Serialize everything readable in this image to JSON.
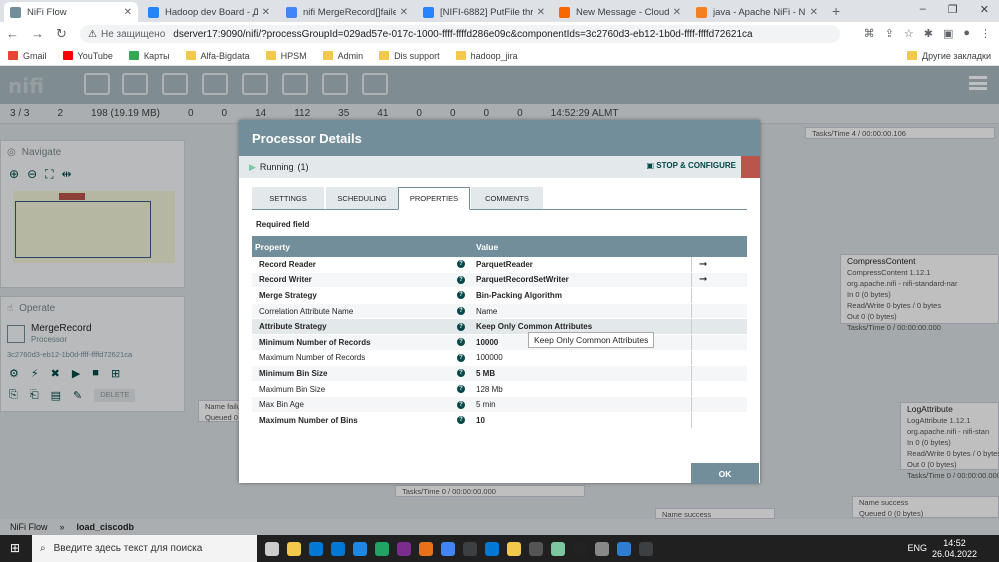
{
  "browser": {
    "tabs": [
      {
        "title": "NiFi Flow",
        "color": "#728e9b"
      },
      {
        "title": "Hadoop dev Board - Доска",
        "color": "#2684ff"
      },
      {
        "title": "nifi MergeRecord[]failed to",
        "color": "#4285f4"
      },
      {
        "title": "[NIFI-6882] PutFile throws",
        "color": "#2684ff"
      },
      {
        "title": "New Message - Cloudera C",
        "color": "#f96702"
      },
      {
        "title": "java - Apache NiFi - NullPo",
        "color": "#f48024"
      }
    ],
    "security_label": "Не защищено",
    "url": "dserver17:9090/nifi/?processGroupId=029ad57e-017c-1000-ffff-ffffd286e09c&componentIds=3c2760d3-eb12-1b0d-ffff-ffffd72621ca",
    "bookmarks": [
      {
        "label": "Gmail",
        "color": "#ea4335"
      },
      {
        "label": "YouTube",
        "color": "#ff0000"
      },
      {
        "label": "Карты",
        "color": "#34a853"
      },
      {
        "label": "Alfa-Bigdata",
        "color": "#f2c94c"
      },
      {
        "label": "HPSM",
        "color": "#f2c94c"
      },
      {
        "label": "Admin",
        "color": "#f2c94c"
      },
      {
        "label": "Dis support",
        "color": "#f2c94c"
      },
      {
        "label": "hadoop_jira",
        "color": "#f2c94c"
      }
    ],
    "other_bookmarks": "Другие закладки"
  },
  "nifi": {
    "status": [
      "3 / 3",
      "2",
      "198 (19.19 MB)",
      "0",
      "0",
      "14",
      "112",
      "35",
      "41",
      "0",
      "0",
      "0",
      "0",
      "14:52:29 ALMT"
    ],
    "navigate_title": "Navigate",
    "operate_title": "Operate",
    "operate_name": "MergeRecord",
    "operate_type": "Processor",
    "operate_id": "3c2760d3-eb12-1b0d-ffff-ffffd72621ca",
    "operate_delete": "DELETE",
    "breadcrumb": [
      "NiFi Flow",
      "load_ciscodb"
    ],
    "canvas": {
      "compress_name": "CompressContent",
      "compress_ver": "CompressContent 1.12.1",
      "compress_pkg": "org.apache.nifi - nifi-standard-nar",
      "compress_rows": [
        "In   0 (0 bytes)",
        "Read/Write   0 bytes / 0 bytes",
        "Out   0 (0 bytes)",
        "Tasks/Time   0 / 00:00:00.000"
      ],
      "log_name": "LogAttribute",
      "log_ver": "LogAttribute 1.12.1",
      "log_pkg": "org.apache.nifi - nifi-stan",
      "log_rows": [
        "In   0 (0 bytes)",
        "Read/Write   0 bytes / 0 bytes",
        "Out   0 (0 bytes)",
        "Tasks/Time   0 / 00:00:00.000"
      ],
      "tasks_top": "Tasks/Time   4 / 00:00:00.106",
      "tasks_bottom": "Tasks/Time   0 / 00:00:00.000",
      "name_success": "Name   success",
      "queued_zero": "Queued   0 (0 bytes)",
      "name_success2": "Name   success",
      "name_failure": "Name   failur",
      "queued_left": "Queued   0 (0",
      "five_min": "5 min"
    }
  },
  "dialog": {
    "title": "Processor Details",
    "state": "Running",
    "count": "(1)",
    "stop_configure": "STOP & CONFIGURE",
    "tabs": [
      "SETTINGS",
      "SCHEDULING",
      "PROPERTIES",
      "COMMENTS"
    ],
    "required_field": "Required field",
    "col_property": "Property",
    "col_value": "Value",
    "help_glyph": "?",
    "arrow_glyph": "➞",
    "rows": [
      {
        "name": "Record Reader",
        "value": "ParquetReader",
        "arrow": true,
        "bold": true,
        "vbold": true
      },
      {
        "name": "Record Writer",
        "value": "ParquetRecordSetWriter",
        "arrow": true,
        "bold": true,
        "vbold": true
      },
      {
        "name": "Merge Strategy",
        "value": "Bin-Packing Algorithm",
        "arrow": false,
        "bold": true,
        "vbold": true
      },
      {
        "name": "Correlation Attribute Name",
        "value": "Name",
        "arrow": false,
        "bold": false,
        "vbold": false
      },
      {
        "name": "Attribute Strategy",
        "value": "Keep Only Common Attributes",
        "arrow": false,
        "bold": true,
        "vbold": true
      },
      {
        "name": "Minimum Number of Records",
        "value": "10000",
        "arrow": false,
        "bold": true,
        "vbold": true
      },
      {
        "name": "Maximum Number of Records",
        "value": "100000",
        "arrow": false,
        "bold": false,
        "vbold": false
      },
      {
        "name": "Minimum Bin Size",
        "value": "5 MB",
        "arrow": false,
        "bold": true,
        "vbold": true
      },
      {
        "name": "Maximum Bin Size",
        "value": "128 Mb",
        "arrow": false,
        "bold": false,
        "vbold": false
      },
      {
        "name": "Max Bin Age",
        "value": "5 min",
        "arrow": false,
        "bold": false,
        "vbold": false
      },
      {
        "name": "Maximum Number of Bins",
        "value": "10",
        "arrow": false,
        "bold": true,
        "vbold": true
      }
    ],
    "tooltip": "Keep Only Common Attributes",
    "ok": "OK"
  },
  "taskbar": {
    "search": "Введите здесь текст для поиска",
    "lang": "ENG",
    "time": "14:52",
    "date": "26.04.2022"
  }
}
